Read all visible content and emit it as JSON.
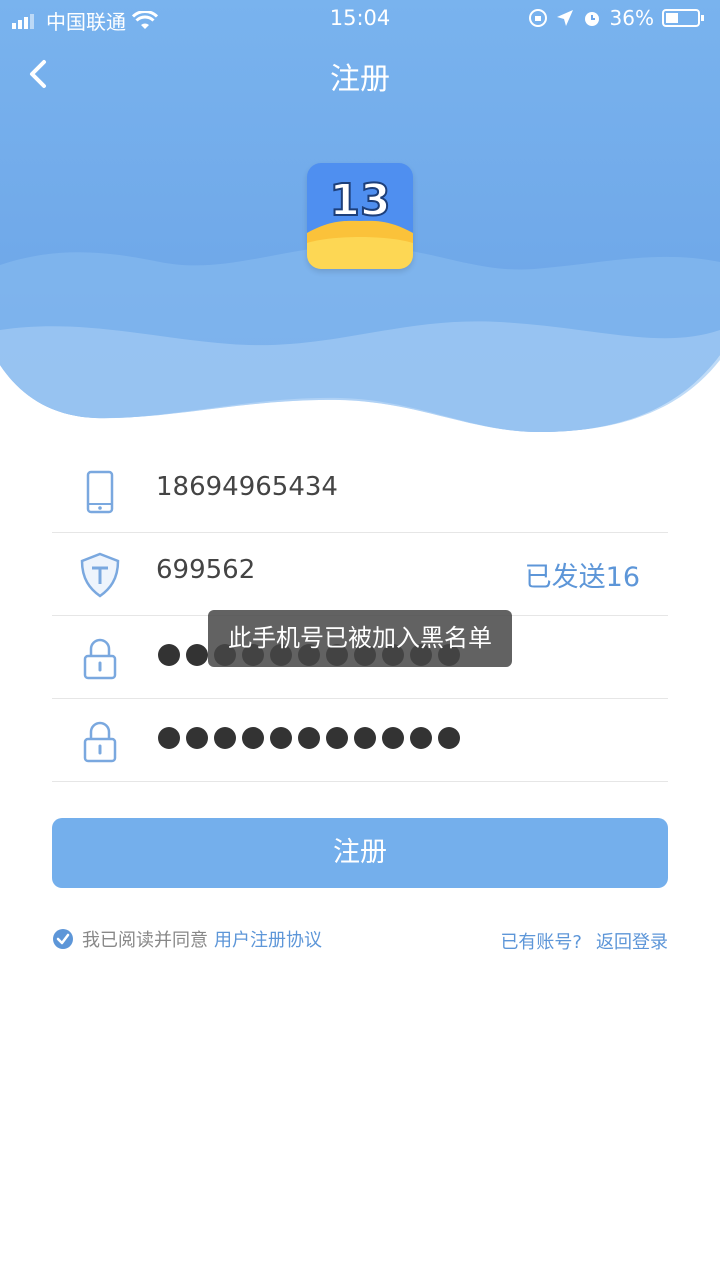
{
  "status_bar": {
    "carrier": "中国联通",
    "time": "15:04",
    "battery": "36%"
  },
  "nav": {
    "title": "注册"
  },
  "logo": {
    "number": "13"
  },
  "form": {
    "phone": "18694965434",
    "code": "699562",
    "code_status": "已发送16",
    "password_dots": 11,
    "confirm_dots": 11
  },
  "toast": "此手机号已被加入黑名单",
  "register_button": "注册",
  "agreement": {
    "prefix": "我已阅读并同意",
    "link": "用户注册协议",
    "checked": true
  },
  "login": {
    "question": "已有账号?",
    "link": "返回登录"
  },
  "colors": {
    "header_blue": "#6ea7eb",
    "button": "#74afec",
    "link": "#5d96d8"
  }
}
